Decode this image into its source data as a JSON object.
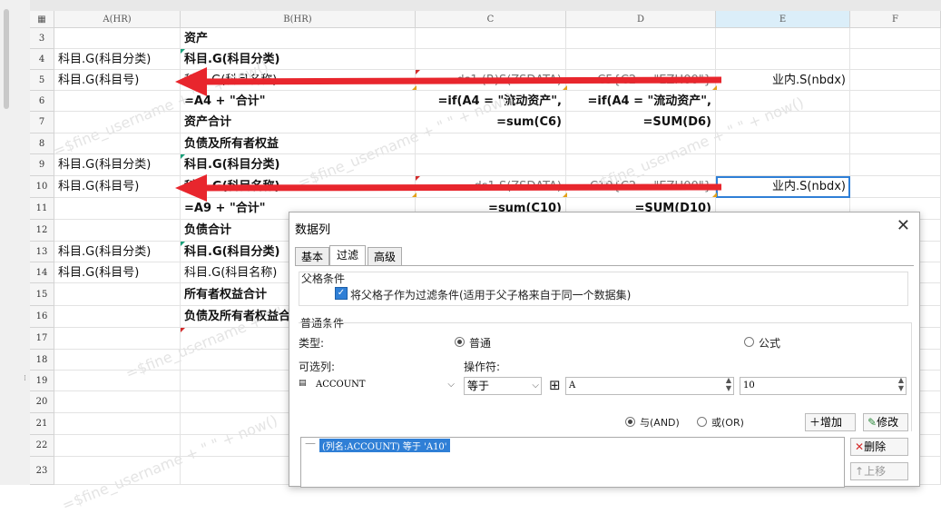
{
  "columns": {
    "a": "A(HR)",
    "b": "B(HR)",
    "c": "C",
    "d": "D",
    "e": "E",
    "f": "F"
  },
  "rows": {
    "r3": {
      "n": "3",
      "b": "资产"
    },
    "r4": {
      "n": "4",
      "a": "科目.G(科目分类)",
      "b": "科目.G(科目分类)"
    },
    "r5": {
      "n": "5",
      "a": "科目.G(科目号)",
      "b": "科目.G(科目名称)",
      "c": "ds1.(R)S(ZSDATA)",
      "d": "C5{C2 = \"EZH00\"}",
      "e": "业内.S(nbdx)"
    },
    "r6": {
      "n": "6",
      "b": "=A4 + \"合计\"",
      "c": "=if(A4 = \"流动资产\",",
      "d": "=if(A4 = \"流动资产\","
    },
    "r7": {
      "n": "7",
      "b": "资产合计",
      "c": "=sum(C6)",
      "d": "=SUM(D6)"
    },
    "r8": {
      "n": "8",
      "b": "负债及所有者权益"
    },
    "r9": {
      "n": "9",
      "a": "科目.G(科目分类)",
      "b": "科目.G(科目分类)"
    },
    "r10": {
      "n": "10",
      "a": "科目.G(科目号)",
      "b": "科目.G(科目名称)",
      "c": "ds1.S(ZSDATA)",
      "d": "C10{C2 = \"EZH00\"}",
      "e": "业内.S(nbdx)"
    },
    "r11": {
      "n": "11",
      "b": "=A9 + \"合计\"",
      "c": "=sum(C10)",
      "d": "=SUM(D10)"
    },
    "r12": {
      "n": "12",
      "b": "负债合计"
    },
    "r13": {
      "n": "13",
      "a": "科目.G(科目分类)",
      "b": "科目.G(科目分类)"
    },
    "r14": {
      "n": "14",
      "a": "科目.G(科目号)",
      "b": "科目.G(科目名称)"
    },
    "r15": {
      "n": "15",
      "b": "所有者权益合计"
    },
    "r16": {
      "n": "16",
      "b": "负债及所有者权益合计"
    },
    "r17": {
      "n": "17"
    },
    "r18": {
      "n": "18"
    },
    "r19": {
      "n": "19"
    },
    "r20": {
      "n": "20"
    },
    "r21": {
      "n": "21"
    },
    "r22": {
      "n": "22"
    },
    "r23": {
      "n": "23"
    }
  },
  "watermark": "=$fine_username + \" \" + now()",
  "dialog": {
    "title": "数据列",
    "tabs": [
      "基本",
      "过滤",
      "高级"
    ],
    "parent_group": "父格条件",
    "parent_checkbox": "将父格子作为过滤条件(适用于父子格来自于同一个数据集)",
    "normal_group": "普通条件",
    "type_label": "类型:",
    "type_normal": "普通",
    "type_formula": "公式",
    "column_label": "可选列:",
    "operator_label": "操作符:",
    "column_value": "ACCOUNT",
    "operator_value": "等于",
    "value_a": "A",
    "value_b": "10",
    "and_label": "与(AND)",
    "or_label": "或(OR)",
    "add_label": "增加",
    "modify_label": "修改",
    "delete_label": "删除",
    "moveup_label": "上移",
    "condition": "(列名:ACCOUNT) 等于 'A10'"
  },
  "arrow_color": "#e8262d"
}
